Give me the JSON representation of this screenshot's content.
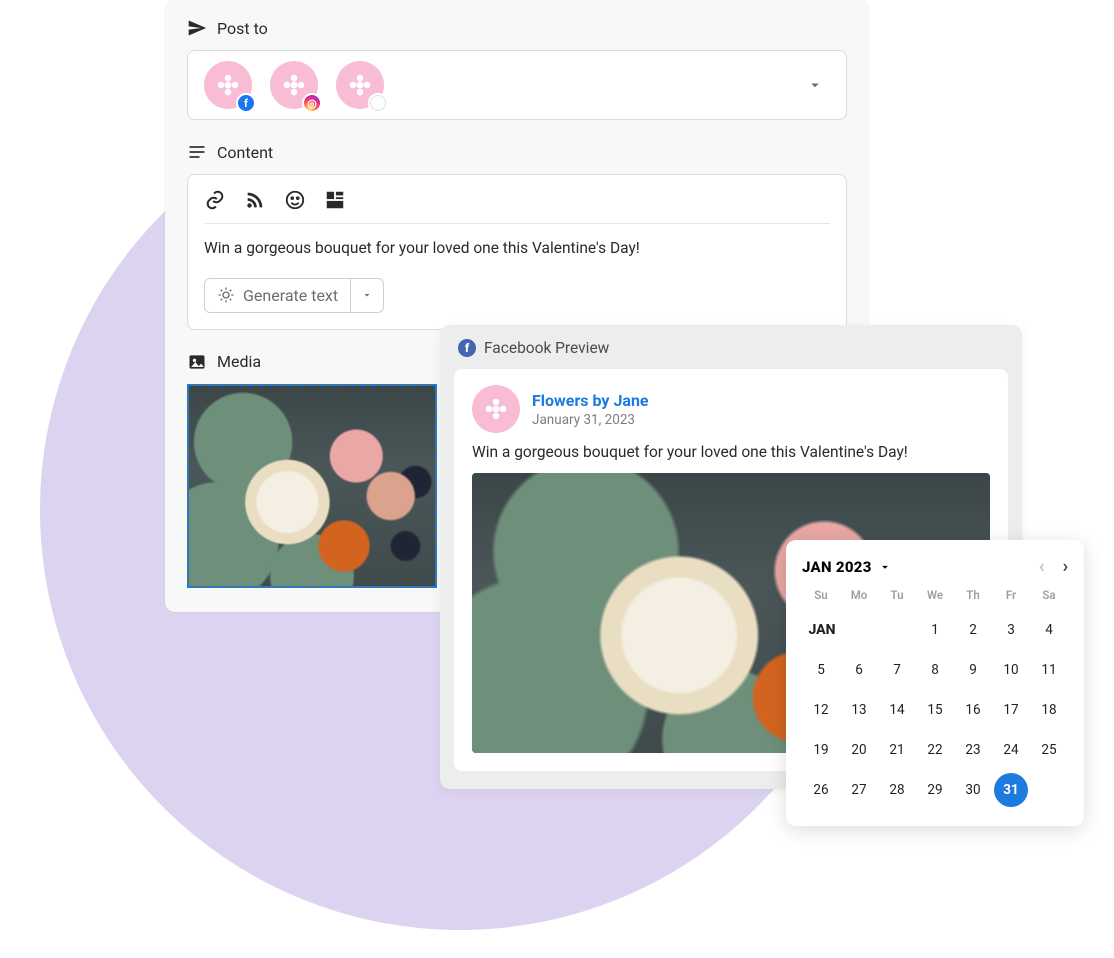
{
  "composer": {
    "post_to_label": "Post to",
    "targets": [
      {
        "network": "facebook",
        "icon": "facebook-icon",
        "brand": "Flowers by Jane"
      },
      {
        "network": "instagram",
        "icon": "instagram-icon",
        "brand": "Flowers by Jane"
      },
      {
        "network": "google",
        "icon": "google-icon",
        "brand": "Flowers by Jane"
      }
    ],
    "content_label": "Content",
    "toolbar": {
      "link": "link-icon",
      "rss": "rss-icon",
      "emoji": "emoji-icon",
      "grid": "template-grid-icon"
    },
    "content_text": "Win a gorgeous bouquet for your loved one this Valentine's Day!",
    "generate_button": "Generate text",
    "media_label": "Media"
  },
  "preview": {
    "heading": "Facebook Preview",
    "author_name": "Flowers by Jane",
    "post_date": "January 31, 2023",
    "body_text": "Win a gorgeous bouquet for your loved one this Valentine's Day!"
  },
  "calendar": {
    "title": "JAN 2023",
    "month_short": "JAN",
    "dow": [
      "Su",
      "Mo",
      "Tu",
      "We",
      "Th",
      "Fr",
      "Sa"
    ],
    "rows": [
      {
        "first_cell_is_label": true,
        "cells": [
          "",
          "",
          "",
          "1",
          "2",
          "3",
          "4"
        ]
      },
      {
        "cells": [
          "5",
          "6",
          "7",
          "8",
          "9",
          "10",
          "11"
        ]
      },
      {
        "cells": [
          "12",
          "13",
          "14",
          "15",
          "16",
          "17",
          "18"
        ]
      },
      {
        "cells": [
          "19",
          "20",
          "21",
          "22",
          "23",
          "24",
          "25"
        ]
      },
      {
        "cells": [
          "26",
          "27",
          "28",
          "29",
          "30",
          "31",
          ""
        ]
      }
    ],
    "selected_day": "31"
  }
}
